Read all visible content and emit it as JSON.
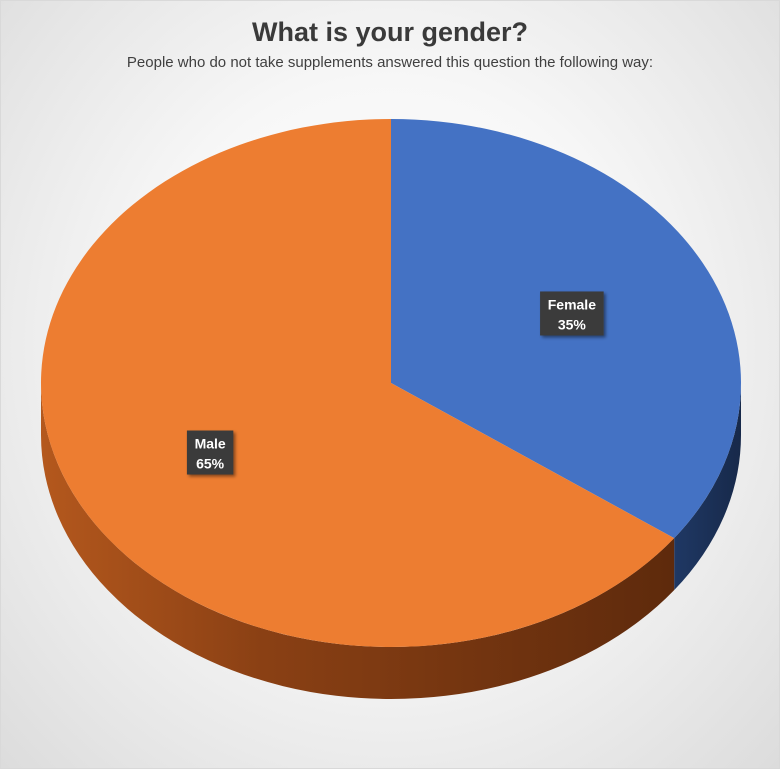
{
  "chart_data": {
    "type": "pie",
    "title": "What is your gender?",
    "subtitle": "People who do not take supplements answered this question the following way:",
    "slices": [
      {
        "label": "Female",
        "value": 35,
        "value_label": "35%",
        "color": "#4472c4",
        "side_color": "#1f3864"
      },
      {
        "label": "Male",
        "value": 65,
        "value_label": "65%",
        "color": "#ed7d31",
        "side_color": "#843c0c"
      }
    ],
    "three_d": true,
    "legend": "none",
    "data_labels": "inside"
  }
}
